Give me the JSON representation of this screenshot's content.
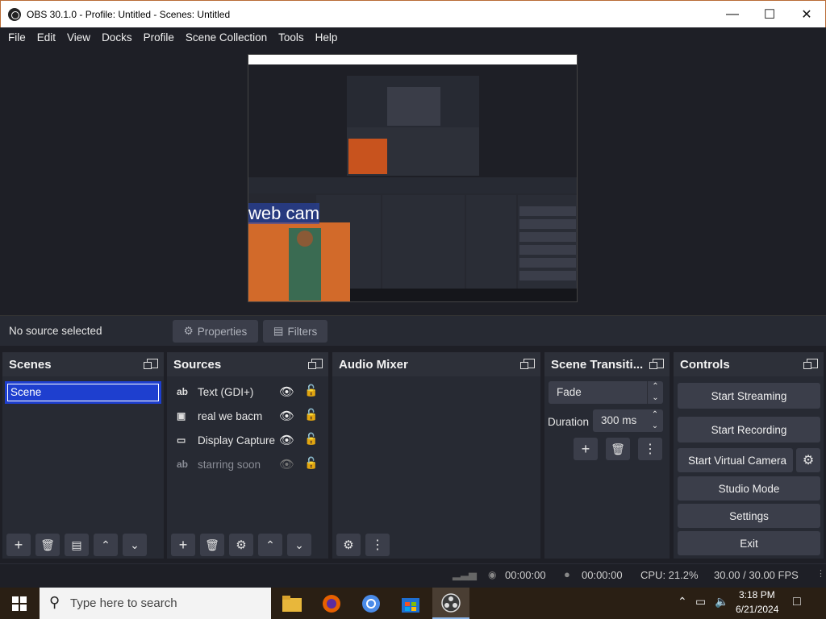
{
  "window": {
    "title": "OBS 30.1.0 - Profile: Untitled - Scenes: Untitled",
    "minimize_icon": "minimize-icon",
    "maximize_icon": "maximize-icon",
    "close_icon": "close-icon"
  },
  "menu": [
    "File",
    "Edit",
    "View",
    "Docks",
    "Profile",
    "Scene Collection",
    "Tools",
    "Help"
  ],
  "source_bar": {
    "status": "No source selected",
    "properties_label": "Properties",
    "filters_label": "Filters"
  },
  "scenes": {
    "title": "Scenes",
    "items": [
      "Scene"
    ]
  },
  "sources": {
    "title": "Sources",
    "items": [
      {
        "icon": "text-icon",
        "label": "Text (GDI+)",
        "visible": true
      },
      {
        "icon": "image-icon",
        "label": "real we bacm",
        "visible": true
      },
      {
        "icon": "monitor-icon",
        "label": "Display Capture",
        "visible": true
      },
      {
        "icon": "text-icon",
        "label": "starring soon",
        "visible": false
      }
    ]
  },
  "audio_mixer": {
    "title": "Audio Mixer"
  },
  "transitions": {
    "title": "Scene Transiti...",
    "selected": "Fade",
    "duration_label": "Duration",
    "duration_value": "300 ms"
  },
  "controls": {
    "title": "Controls",
    "start_streaming": "Start Streaming",
    "start_recording": "Start Recording",
    "start_virtual_camera": "Start Virtual Camera",
    "studio_mode": "Studio Mode",
    "settings": "Settings",
    "exit": "Exit"
  },
  "status": {
    "stream_time": "00:00:00",
    "record_time": "00:00:00",
    "cpu": "CPU: 21.2%",
    "fps": "30.00 / 30.00 FPS"
  },
  "preview_overlay": {
    "webcam_text": "web cam"
  },
  "taskbar": {
    "search_placeholder": "Type here to search",
    "time": "3:18 PM",
    "date": "6/21/2024"
  },
  "colors": {
    "background": "#1e1f26",
    "panel": "#272a33",
    "button": "#3b3e4a",
    "selected_scene": "#1e3fcf"
  }
}
